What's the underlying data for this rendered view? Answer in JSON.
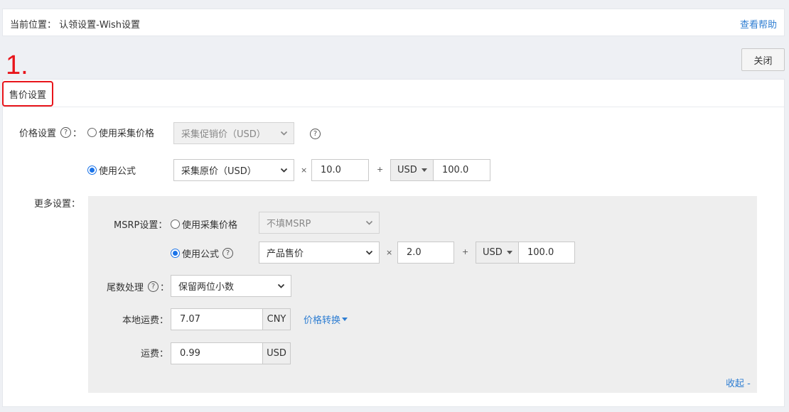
{
  "breadcrumb": {
    "text": "当前位置：  认领设置-Wish设置"
  },
  "help_link": "查看帮助",
  "annotation": "1.",
  "close_button": "关闭",
  "panel": {
    "title": "售价设置"
  },
  "price_setting": {
    "label": "价格设置",
    "help_glyph": "?",
    "colon": "：",
    "option_collect": {
      "label": "使用采集价格",
      "selected": false,
      "select_value": "采集促销价（USD）",
      "disabled": true
    },
    "option_formula": {
      "label": "使用公式",
      "selected": true,
      "select_value": "采集原价（USD）",
      "multiply_symbol": "×",
      "multiplier": "10.0",
      "plus_symbol": "+",
      "currency": "USD",
      "addend": "100.0"
    }
  },
  "more_settings": {
    "label": "更多设置：",
    "msrp": {
      "label": "MSRP设置：",
      "option_collect": {
        "label": "使用采集价格",
        "selected": false,
        "select_value": "不填MSRP",
        "disabled": true
      },
      "option_formula": {
        "label": "使用公式",
        "selected": true,
        "select_value": "产品售价",
        "multiply_symbol": "×",
        "multiplier": "2.0",
        "plus_symbol": "+",
        "currency": "USD",
        "addend": "100.0"
      }
    },
    "rounding": {
      "label": "尾数处理",
      "colon": "：",
      "value": "保留两位小数"
    },
    "local_shipping": {
      "label": "本地运费：",
      "value": "7.07",
      "unit": "CNY",
      "convert_link": "价格转换"
    },
    "shipping": {
      "label": "运费：",
      "value": "0.99",
      "unit": "USD"
    },
    "collapse_link": "收起 -"
  }
}
